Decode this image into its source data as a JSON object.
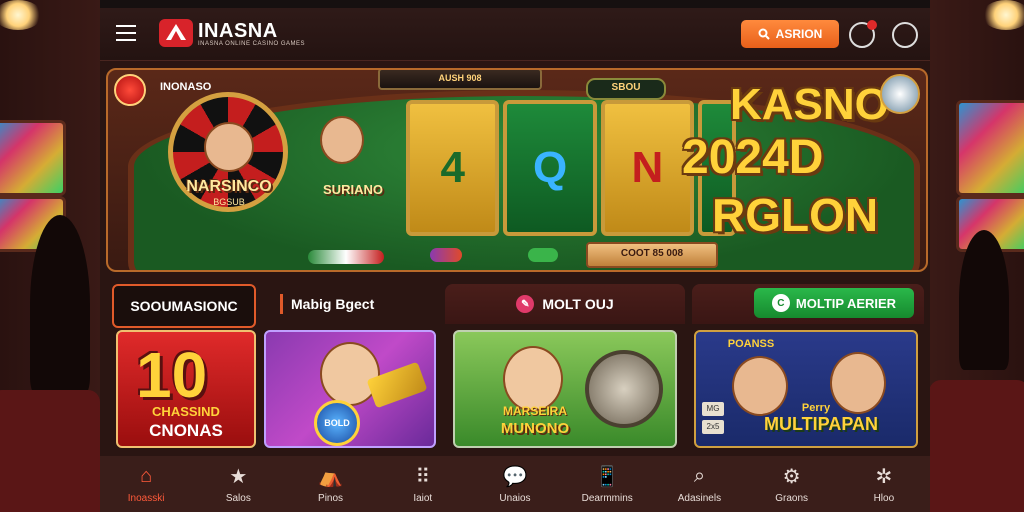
{
  "header": {
    "brand": "INASNA",
    "brand_sub": "INASNA ONLINE CASINO GAMES",
    "action_button": "ASRION"
  },
  "hero": {
    "brand_tag": "INONASO",
    "top_plaque": "AUSH 908",
    "slot_plaque": "SBOU",
    "wheel_title": "NARSINCO",
    "wheel_sub": "BGSUB",
    "char_title": "SURIANO",
    "reels": [
      "4",
      "Q",
      "N"
    ],
    "title_lines": [
      "KASNO",
      "2024D",
      "RGLON"
    ],
    "bottom_panel": "COOT 85 008"
  },
  "tabs": {
    "active": "SOOUMASIONC",
    "plain": "Mabig Bgect",
    "mid": "MOLT OUJ",
    "right": "MOLTIP AERIER"
  },
  "cards": {
    "card1": {
      "number": "10",
      "line1": "CHASSIND",
      "line2": "CNONAS"
    },
    "card2": {
      "badge": "BOLD"
    },
    "card3": {
      "line1": "MARSEIRA",
      "line2": "MUNONO"
    },
    "card4": {
      "title": "POANSS",
      "line1": "Perry",
      "line2": "MULTIPAPAN",
      "tags": [
        "MG",
        "2x5"
      ]
    }
  },
  "nav": [
    {
      "label": "Inoasski",
      "icon": "home-icon",
      "glyph": "⌂"
    },
    {
      "label": "Salos",
      "icon": "star-icon",
      "glyph": "★"
    },
    {
      "label": "Pinos",
      "icon": "tent-icon",
      "glyph": "⛺"
    },
    {
      "label": "Iaiot",
      "icon": "grid-icon",
      "glyph": "⠿"
    },
    {
      "label": "Unaios",
      "icon": "chat-icon",
      "glyph": "💬"
    },
    {
      "label": "Dearmmins",
      "icon": "phone-icon",
      "glyph": "📱"
    },
    {
      "label": "Adasinels",
      "icon": "search-icon",
      "glyph": "⌕"
    },
    {
      "label": "Graons",
      "icon": "gear-icon",
      "glyph": "⚙"
    },
    {
      "label": "Hloo",
      "icon": "settings-icon",
      "glyph": "✲"
    }
  ],
  "colors": {
    "accent": "#e8601a",
    "active_nav": "#ff5a3a",
    "green_pill": "#2ab84a",
    "gold": "#ffd23a"
  }
}
